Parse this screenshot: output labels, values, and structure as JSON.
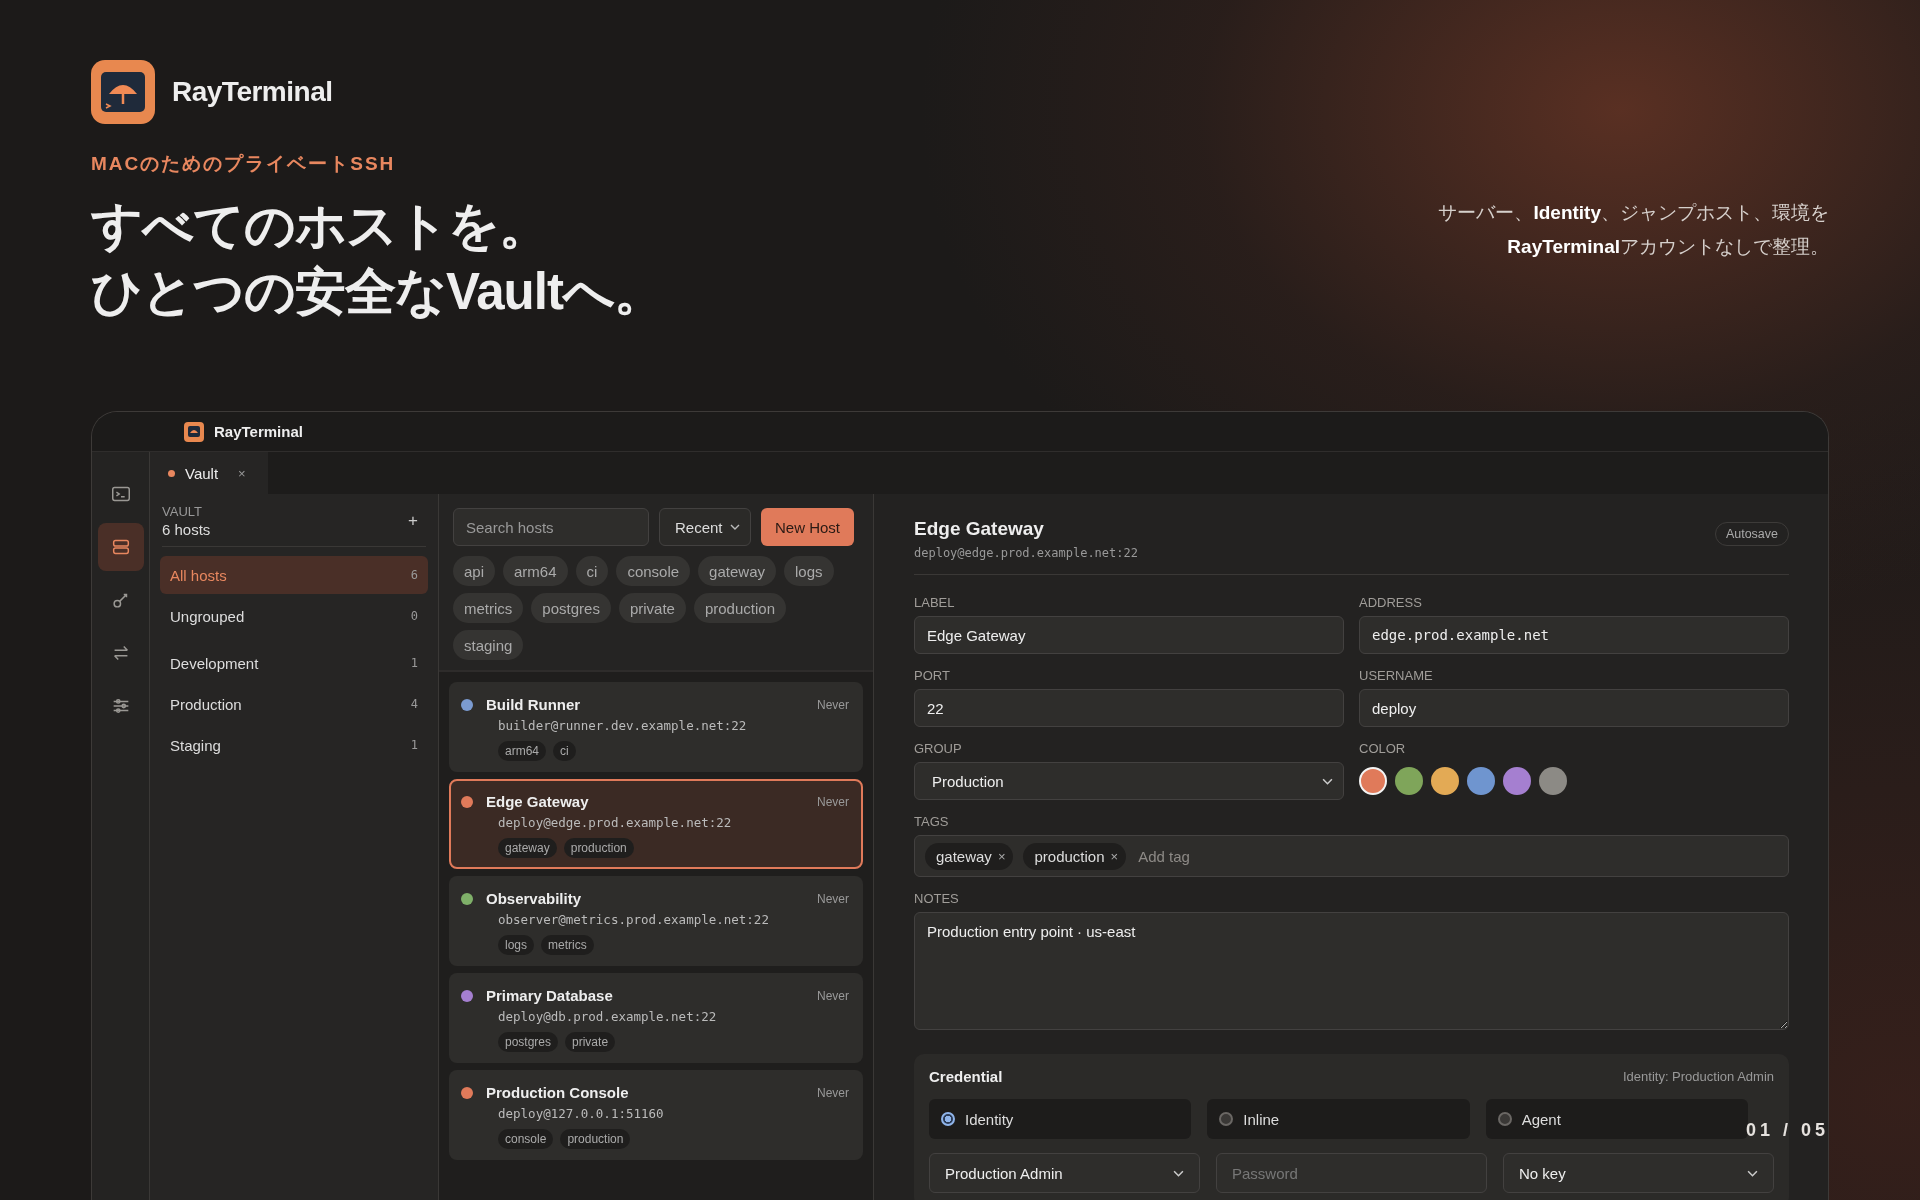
{
  "brand": {
    "name": "RayTerminal"
  },
  "eyebrow": "MACのためのプライベートSSH",
  "headline": [
    "すべてのホストを。",
    "ひとつの安全なVaultへ。"
  ],
  "tagline": [
    "サーバー、**Identity**、ジャンプホスト、環境を",
    "**RayTerminal**アカウントなしで整理。"
  ],
  "pager": "01 / 05",
  "app": {
    "title": "RayTerminal",
    "rail": [
      {
        "kind": "terminal",
        "selected": false
      },
      {
        "kind": "server",
        "selected": true
      },
      {
        "kind": "key",
        "selected": false
      },
      {
        "kind": "transfer",
        "selected": false
      },
      {
        "kind": "sliders",
        "selected": false
      }
    ],
    "tabs": [
      {
        "label": "Vault",
        "close": "×",
        "selected": true
      }
    ],
    "sidebar": {
      "heading": "VAULT",
      "count": "6 hosts",
      "add": "+",
      "groups": [
        {
          "label": "All hosts",
          "count": "6",
          "selected": true
        },
        {
          "label": "Ungrouped",
          "count": "0",
          "selected": false
        },
        {
          "label": "Development",
          "count": "1",
          "selected": false
        },
        {
          "label": "Production",
          "count": "4",
          "selected": false
        },
        {
          "label": "Staging",
          "count": "1",
          "selected": false
        }
      ]
    },
    "hosts": {
      "search": {
        "placeholder": "Search hosts"
      },
      "sort": "Recent",
      "new_host": "New Host",
      "filters": [
        "api",
        "arm64",
        "ci",
        "console",
        "gateway",
        "logs",
        "metrics",
        "postgres",
        "private",
        "production",
        "staging"
      ],
      "items": [
        {
          "name": "Build Runner",
          "address": "builder@runner.dev.example.net:22",
          "last": "Never",
          "color": "#7b9bd1",
          "tags": [
            "arm64",
            "ci"
          ],
          "selected": false
        },
        {
          "name": "Edge Gateway",
          "address": "deploy@edge.prod.example.net:22",
          "last": "Never",
          "color": "#e07a5a",
          "tags": [
            "gateway",
            "production"
          ],
          "selected": true
        },
        {
          "name": "Observability",
          "address": "observer@metrics.prod.example.net:22",
          "last": "Never",
          "color": "#7fb069",
          "tags": [
            "logs",
            "metrics"
          ],
          "selected": false
        },
        {
          "name": "Primary Database",
          "address": "deploy@db.prod.example.net:22",
          "last": "Never",
          "color": "#a57fd0",
          "tags": [
            "postgres",
            "private"
          ],
          "selected": false
        },
        {
          "name": "Production Console",
          "address": "deploy@127.0.0.1:51160",
          "last": "Never",
          "color": "#e07a5a",
          "tags": [
            "console",
            "production"
          ],
          "selected": false
        }
      ]
    },
    "detail": {
      "title": "Edge Gateway",
      "subtitle": "deploy@edge.prod.example.net:22",
      "badge": "Autosave",
      "fields": [
        {
          "label": "LABEL",
          "value": "Edge Gateway",
          "kind": "text"
        },
        {
          "label": "ADDRESS",
          "value": "edge.prod.example.net",
          "kind": "mono"
        },
        {
          "label": "PORT",
          "value": "22",
          "kind": "text"
        },
        {
          "label": "USERNAME",
          "value": "deploy",
          "kind": "text"
        },
        {
          "label": "GROUP",
          "value": "Production",
          "kind": "select"
        }
      ],
      "color": {
        "label": "COLOR",
        "swatches": [
          {
            "color": "#e07a5a",
            "selected": true
          },
          {
            "color": "#7fa55a",
            "selected": false
          },
          {
            "color": "#e3aa55",
            "selected": false
          },
          {
            "color": "#6f95cf",
            "selected": false
          },
          {
            "color": "#a57fd0",
            "selected": false
          },
          {
            "color": "#8c8a85",
            "selected": false
          }
        ]
      },
      "tags": {
        "label": "TAGS",
        "values": [
          {
            "label": "gateway",
            "remove": "×"
          },
          {
            "label": "production",
            "remove": "×"
          }
        ],
        "placeholder": "Add tag"
      },
      "notes": {
        "label": "NOTES",
        "value": "Production entry point · us-east"
      },
      "credential": {
        "title": "Credential",
        "summary": "Identity: Production Admin",
        "modes": [
          {
            "label": "Identity",
            "selected": true
          },
          {
            "label": "Inline",
            "selected": false
          },
          {
            "label": "Agent",
            "selected": false
          }
        ],
        "inputs": [
          {
            "kind": "select",
            "value": "Production Admin"
          },
          {
            "kind": "input",
            "placeholder": "Password"
          },
          {
            "kind": "select",
            "value": "No key"
          }
        ]
      }
    }
  }
}
